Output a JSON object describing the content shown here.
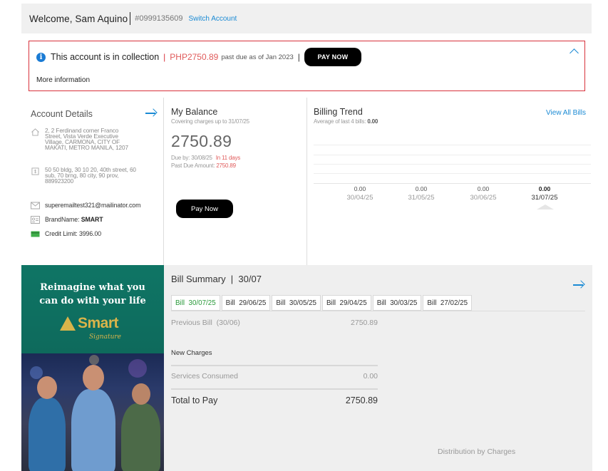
{
  "header": {
    "welcome": "Welcome, Sam Aquino",
    "account_number": "#0999135609",
    "switch_account": "Switch Account"
  },
  "alert": {
    "message": "This account is in collection",
    "amount": "PHP2750.89",
    "past_due_text": "past due as of Jan 2023",
    "pay_now": "PAY NOW",
    "more_info": "More information",
    "colors": {
      "border": "#d8323c",
      "amount": "#e05a5a"
    }
  },
  "account_details": {
    "title": "Account Details",
    "address": "2, 2 Ferdinand corner Franco Street, Vista Verde Executive Village, CARMONA, CITY OF MAKATI, METRO MANILA, 1207",
    "billing_address": "50 50 bldg, 30 10 20, 40th street, 60 sub, 70 brng, 80 city, 90 prov, 889923200",
    "email": "superemailtest321@mailinator.com",
    "brand_label": "BrandName:",
    "brand_value": "SMART",
    "credit_limit": "Credit Limit: 3996.00",
    "icons": [
      "house-icon",
      "billing-icon",
      "mail-icon",
      "id-card-icon",
      "credit-card-icon"
    ]
  },
  "balance": {
    "title": "My Balance",
    "subtitle": "Covering charges up to 31/07/25",
    "amount": "2750.89",
    "due_label": "Due by: 30/08/25",
    "due_in": "In 11 days",
    "past_due_label": "Past Due Amount:",
    "past_due_amount": "2750.89",
    "pay_now": "Pay Now"
  },
  "billing_trend": {
    "title": "Billing Trend",
    "subtitle_label": "Average of last 4 bills:",
    "subtitle_value": "0.00",
    "view_all": "View All Bills",
    "items": [
      {
        "value": "0.00",
        "date": "30/04/25"
      },
      {
        "value": "0.00",
        "date": "31/05/25"
      },
      {
        "value": "0.00",
        "date": "30/06/25"
      },
      {
        "value": "0.00",
        "date": "31/07/25"
      }
    ]
  },
  "banner": {
    "headline_line1": "Reimagine what you",
    "headline_line2": "can do with your life",
    "logo_text": "Smart",
    "logo_sub": "Signature"
  },
  "bill_summary": {
    "title": "Bill Summary",
    "date": "30/07",
    "tabs": [
      {
        "label": "Bill",
        "date": "30/07/25"
      },
      {
        "label": "Bill",
        "date": "29/06/25"
      },
      {
        "label": "Bill",
        "date": "30/05/25"
      },
      {
        "label": "Bill",
        "date": "29/04/25"
      },
      {
        "label": "Bill",
        "date": "30/03/25"
      },
      {
        "label": "Bill",
        "date": "27/02/25"
      }
    ],
    "previous_bill_label": "Previous Bill",
    "previous_bill_date": "(30/06)",
    "previous_bill_value": "2750.89",
    "new_charges": "New Charges",
    "services_consumed_label": "Services Consumed",
    "services_consumed_value": "0.00",
    "total_label": "Total to Pay",
    "total_value": "2750.89",
    "distribution": "Distribution by Charges"
  }
}
